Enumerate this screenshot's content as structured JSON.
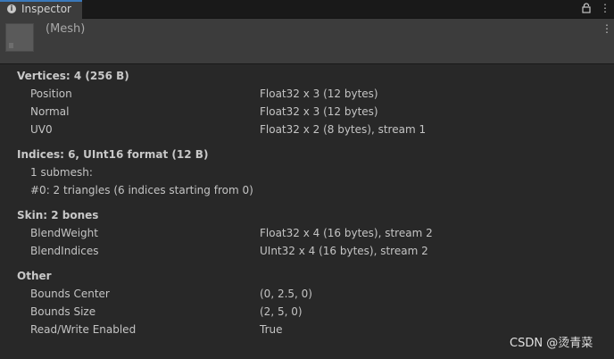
{
  "tab": {
    "title": "Inspector",
    "info_icon": "info-icon",
    "lock_icon": "lock-icon",
    "menu_icon": "kebab-menu-icon"
  },
  "header": {
    "title": "(Mesh)",
    "menu_icon": "kebab-menu-icon"
  },
  "sections": {
    "vertices": {
      "title": "Vertices: 4 (256 B)",
      "rows": [
        {
          "label": "Position",
          "value": "Float32 x 3 (12 bytes)"
        },
        {
          "label": "Normal",
          "value": "Float32 x 3 (12 bytes)"
        },
        {
          "label": "UV0",
          "value": "Float32 x 2 (8 bytes), stream 1"
        }
      ]
    },
    "indices": {
      "title": "Indices: 6, UInt16 format (12 B)",
      "lines": [
        "1 submesh:",
        "#0: 2 triangles (6 indices starting from 0)"
      ]
    },
    "skin": {
      "title": "Skin: 2 bones",
      "rows": [
        {
          "label": "BlendWeight",
          "value": "Float32 x 4 (16 bytes), stream 2"
        },
        {
          "label": "BlendIndices",
          "value": "UInt32 x 4 (16 bytes), stream 2"
        }
      ]
    },
    "other": {
      "title": "Other",
      "rows": [
        {
          "label": "Bounds Center",
          "value": "(0, 2.5, 0)"
        },
        {
          "label": "Bounds Size",
          "value": "(2, 5, 0)"
        },
        {
          "label": "Read/Write Enabled",
          "value": "True"
        }
      ]
    }
  },
  "watermark": "CSDN @烫青菜"
}
